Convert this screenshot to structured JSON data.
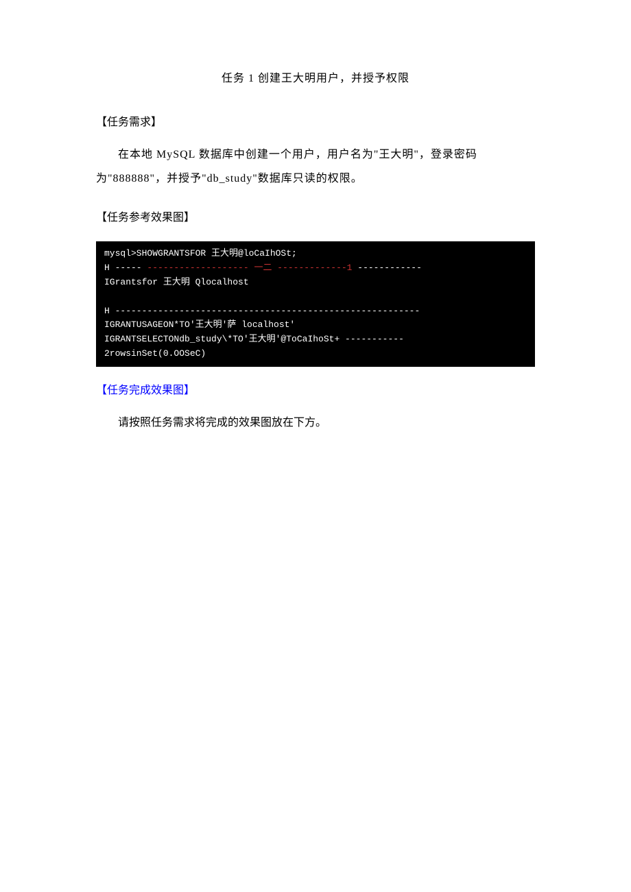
{
  "title": "任务 1 创建王大明用户，并授予权限",
  "sections": {
    "requirement": {
      "heading": "【任务需求】",
      "body": "在本地 MySQL 数据库中创建一个用户，用户名为\"王大明\"，登录密码为\"888888\"，并授予\"db_study\"数据库只读的权限。"
    },
    "reference": {
      "heading": "【任务参考效果图】"
    },
    "completion": {
      "heading": "【任务完成效果图】",
      "body": "请按照任务需求将完成的效果图放在下方。"
    }
  },
  "terminal": {
    "line1": "mysql>SHOWGRANTSFOR 王大明@loCaIhOSt;",
    "line2_prefix": "H ----- ",
    "line2_red": "------------------- 一二 -------------1",
    "line2_suffix": " ------------",
    "line3": "IGrantsfor 王大明 Qlocalhost",
    "line4": "H ---------------------------------------------------------",
    "line5": "IGRANTUSAGEON*TO'王大明'萨 localhost'",
    "line6": "IGRANTSELECTONdb_study\\*TO'王大明'@ToCaIhoSt+ -----------",
    "line7": "2rowsinSet(0.OOSeC)"
  }
}
